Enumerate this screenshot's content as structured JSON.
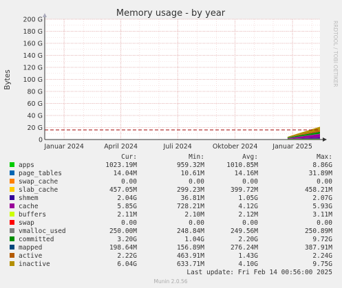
{
  "title": "Memory usage - by year",
  "side_label": "RRDTOOL / TOBI OETIKER",
  "footer": "Munin 2.0.56",
  "last_update": "Last update:  Fri Feb 14 00:56:00 2025",
  "colors": {
    "background": "#f0f0f0",
    "plot": "#ffffff",
    "grid_major": "#e3b1b1",
    "grid_minor": "#f0c8c8",
    "limit_line": "#a00000",
    "axis": "#333333"
  },
  "legend_header": {
    "cur": "Cur:",
    "min": "Min:",
    "avg": "Avg:",
    "max": "Max:"
  },
  "chart_data": {
    "type": "area",
    "title": "Memory usage - by year",
    "ylabel": "Bytes",
    "ylim": [
      0,
      200
    ],
    "y_unit": "G",
    "yticks": [
      "0",
      "20 G",
      "40 G",
      "60 G",
      "80 G",
      "100 G",
      "120 G",
      "140 G",
      "160 G",
      "180 G",
      "200 G"
    ],
    "xlim": [
      "2023-12-01",
      "2025-02-14"
    ],
    "xticks": [
      {
        "label": "Januar 2024",
        "date": "2024-01-01"
      },
      {
        "label": "April 2024",
        "date": "2024-04-01"
      },
      {
        "label": "Juli 2024",
        "date": "2024-07-01"
      },
      {
        "label": "Oktober 2024",
        "date": "2024-10-01"
      },
      {
        "label": "Januar 2025",
        "date": "2025-01-01"
      }
    ],
    "limit_line_y": 16,
    "data_start": "2024-12-24",
    "grid": true,
    "stacked": true,
    "series": [
      {
        "name": "apps",
        "color": "#00cc00",
        "cur": "1023.19M",
        "min": "959.32M",
        "avg": "1010.85M",
        "max": "8.86G",
        "start": 1.0,
        "end": 1.0
      },
      {
        "name": "page_tables",
        "color": "#0066b3",
        "cur": "14.04M",
        "min": "10.61M",
        "avg": "14.16M",
        "max": "31.89M",
        "start": 0.01,
        "end": 0.01
      },
      {
        "name": "swap_cache",
        "color": "#ff8000",
        "cur": "0.00",
        "min": "0.00",
        "avg": "0.00",
        "max": "0.00",
        "start": 0,
        "end": 0
      },
      {
        "name": "slab_cache",
        "color": "#ffcc00",
        "cur": "457.05M",
        "min": "299.23M",
        "avg": "399.72M",
        "max": "458.21M",
        "start": 0.3,
        "end": 0.45
      },
      {
        "name": "shmem",
        "color": "#330099",
        "cur": "2.04G",
        "min": "36.81M",
        "avg": "1.05G",
        "max": "2.07G",
        "start": 0.04,
        "end": 2.04
      },
      {
        "name": "cache",
        "color": "#990099",
        "cur": "5.85G",
        "min": "728.21M",
        "avg": "4.12G",
        "max": "5.93G",
        "start": 0.73,
        "end": 5.85
      },
      {
        "name": "buffers",
        "color": "#ccff00",
        "cur": "2.11M",
        "min": "2.10M",
        "avg": "2.12M",
        "max": "3.11M",
        "start": 0.002,
        "end": 0.002
      },
      {
        "name": "swap",
        "color": "#ff0000",
        "cur": "0.00",
        "min": "0.00",
        "avg": "0.00",
        "max": "0.00",
        "start": 0,
        "end": 0
      },
      {
        "name": "vmalloc_used",
        "color": "#808080",
        "cur": "250.00M",
        "min": "248.84M",
        "avg": "249.56M",
        "max": "250.89M",
        "start": 0.25,
        "end": 0.25
      },
      {
        "name": "committed",
        "color": "#008f00",
        "cur": "3.20G",
        "min": "1.04G",
        "avg": "2.20G",
        "max": "9.72G",
        "start": 1.04,
        "end": 3.2
      },
      {
        "name": "mapped",
        "color": "#00487d",
        "cur": "198.64M",
        "min": "156.89M",
        "avg": "276.24M",
        "max": "387.91M",
        "start": 0.16,
        "end": 0.2
      },
      {
        "name": "active",
        "color": "#b35a00",
        "cur": "2.22G",
        "min": "463.91M",
        "avg": "1.43G",
        "max": "2.24G",
        "start": 0.46,
        "end": 2.22
      },
      {
        "name": "inactive",
        "color": "#b38f00",
        "cur": "6.04G",
        "min": "633.71M",
        "avg": "4.10G",
        "max": "9.75G",
        "start": 0.63,
        "end": 6.04
      }
    ]
  }
}
